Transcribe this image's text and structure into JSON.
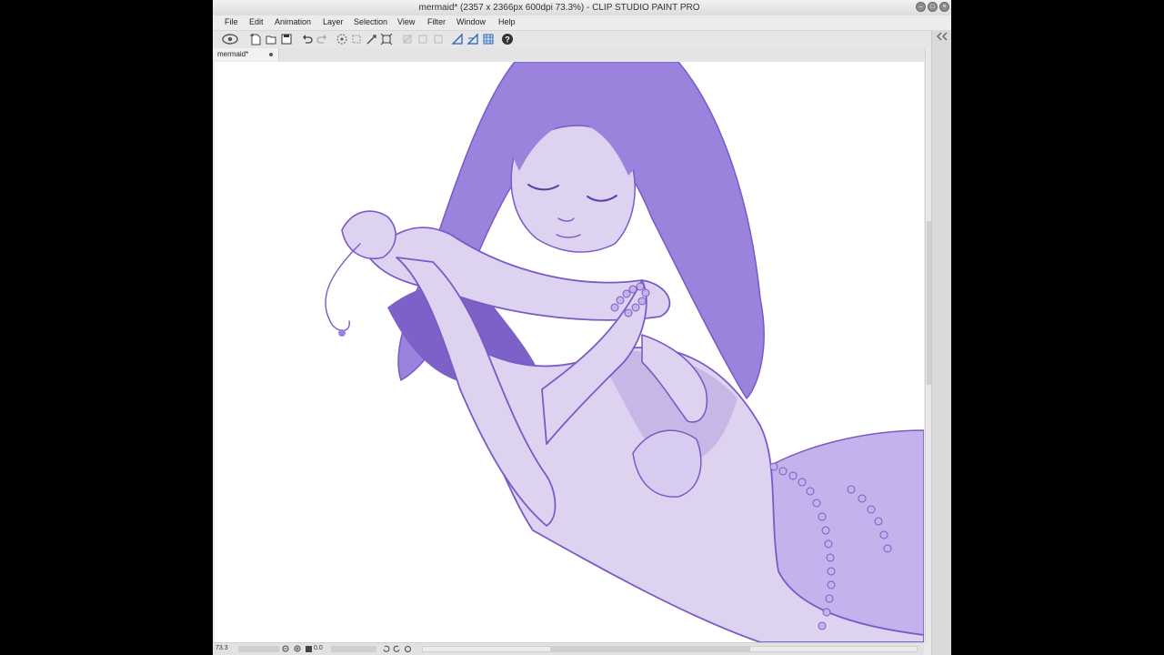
{
  "window": {
    "title": "mermaid* (2357 x 2366px 600dpi 73.3%)  - CLIP STUDIO PAINT PRO"
  },
  "menu": {
    "items": [
      "File",
      "Edit",
      "Animation",
      "Layer",
      "Selection",
      "View",
      "Filter",
      "Window",
      "Help"
    ]
  },
  "toolbar": {
    "icons": [
      "clip-studio-logo-icon",
      "new-file-icon",
      "open-file-icon",
      "save-icon",
      "undo-icon",
      "redo-icon",
      "clear-selection-icon",
      "crop-icon",
      "transform-icon",
      "scale-icon",
      "fill-icon",
      "clear-icon",
      "snap-ruler-icon",
      "snap-special-ruler-icon",
      "snap-grid-icon",
      "help-icon"
    ]
  },
  "tab": {
    "label": "mermaid*"
  },
  "status": {
    "zoom": "73.3",
    "rotation": "0.0"
  },
  "colors": {
    "line": "#7a5ac6",
    "hair": "#9b7fd9",
    "hair_shadow": "#7e60c9",
    "skin": "#ddd3f0",
    "skin_shadow": "#c7b7e6",
    "tail": "#c4b2ec"
  }
}
